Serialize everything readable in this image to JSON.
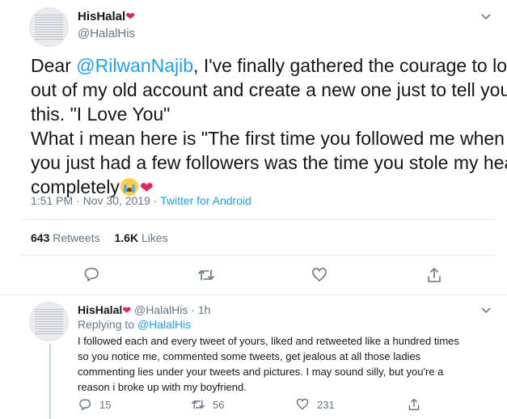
{
  "main_tweet": {
    "display_name": "HisHalal",
    "handle": "@HalalHis",
    "text_prefix": "Dear ",
    "mention": "@RilwanNajib",
    "line1_rest": ", I've finally gathered the courage to log",
    "line2": "out of my old account and create a new one just  to tell you",
    "line3": "this. \"I Love You\"",
    "line4": "What i mean here is \"The first time you followed me when",
    "line5": "you just had a few followers was the time you stole my heart",
    "line6": "completely",
    "time": "1:51 PM · Nov 30, 2019 · ",
    "source": "Twitter for Android",
    "retweets_count": "643",
    "retweets_label": "Retweets",
    "likes_count": "1.6K",
    "likes_label": "Likes"
  },
  "reply_tweet": {
    "display_name": "HisHalal",
    "handle": "@HalalHis",
    "time": " · 1h",
    "replying_to_label": "Replying to ",
    "replying_to_handle": "@HalalHis",
    "line1": "I followed each and every tweet of yours, liked and retweeted like a hundred times",
    "line2": "so you notice me, commented some tweets, get jealous at all those ladies",
    "line3": "commenting lies under your tweets and pictures. I may sound silly, but you're a",
    "line4": "reason i broke up with my boyfriend.",
    "reply_count": "15",
    "retweet_count": "56",
    "like_count": "231"
  },
  "colors": {
    "accent": "#1da1f2",
    "heart": "#e0245e",
    "muted": "#657786"
  },
  "icons": [
    "chevron-down-icon",
    "reply-icon",
    "retweet-icon",
    "like-icon",
    "share-icon",
    "heart-emoji-icon",
    "crying-face-emoji-icon"
  ]
}
